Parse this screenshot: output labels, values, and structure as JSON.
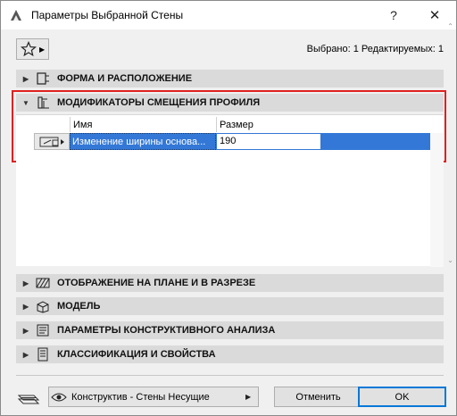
{
  "window": {
    "title": "Параметры Выбранной Стены",
    "help_label": "?",
    "close_label": "✕"
  },
  "toolbar": {
    "selected_info": "Выбрано: 1 Редактируемых: 1"
  },
  "panels": [
    {
      "label": "ФОРМА И РАСПОЛОЖЕНИЕ",
      "icon": "wall-geometry-icon",
      "expanded": false
    },
    {
      "label": "МОДИФИКАТОРЫ СМЕЩЕНИЯ ПРОФИЛЯ",
      "icon": "profile-modifier-icon",
      "expanded": true
    },
    {
      "label": "ОТОБРАЖЕНИЕ НА ПЛАНЕ И В РАЗРЕЗЕ",
      "icon": "floor-plan-icon",
      "expanded": false
    },
    {
      "label": "МОДЕЛЬ",
      "icon": "model-box-icon",
      "expanded": false
    },
    {
      "label": "ПАРАМЕТРЫ КОНСТРУКТИВНОГО АНАЛИЗА",
      "icon": "structural-analysis-icon",
      "expanded": false
    },
    {
      "label": "КЛАССИФИКАЦИЯ И СВОЙСТВА",
      "icon": "classification-icon",
      "expanded": false
    }
  ],
  "modifiers_table": {
    "columns": [
      "Имя",
      "Размер"
    ],
    "rows": [
      {
        "name": "Изменение ширины основа...",
        "size": "190"
      }
    ]
  },
  "footer": {
    "favorite_value": "Конструктив - Стены Несущие",
    "cancel_label": "Отменить",
    "ok_label": "OK"
  },
  "colors": {
    "selection": "#3378d6",
    "highlight_border": "#e02020",
    "panel_header": "#dadada"
  }
}
